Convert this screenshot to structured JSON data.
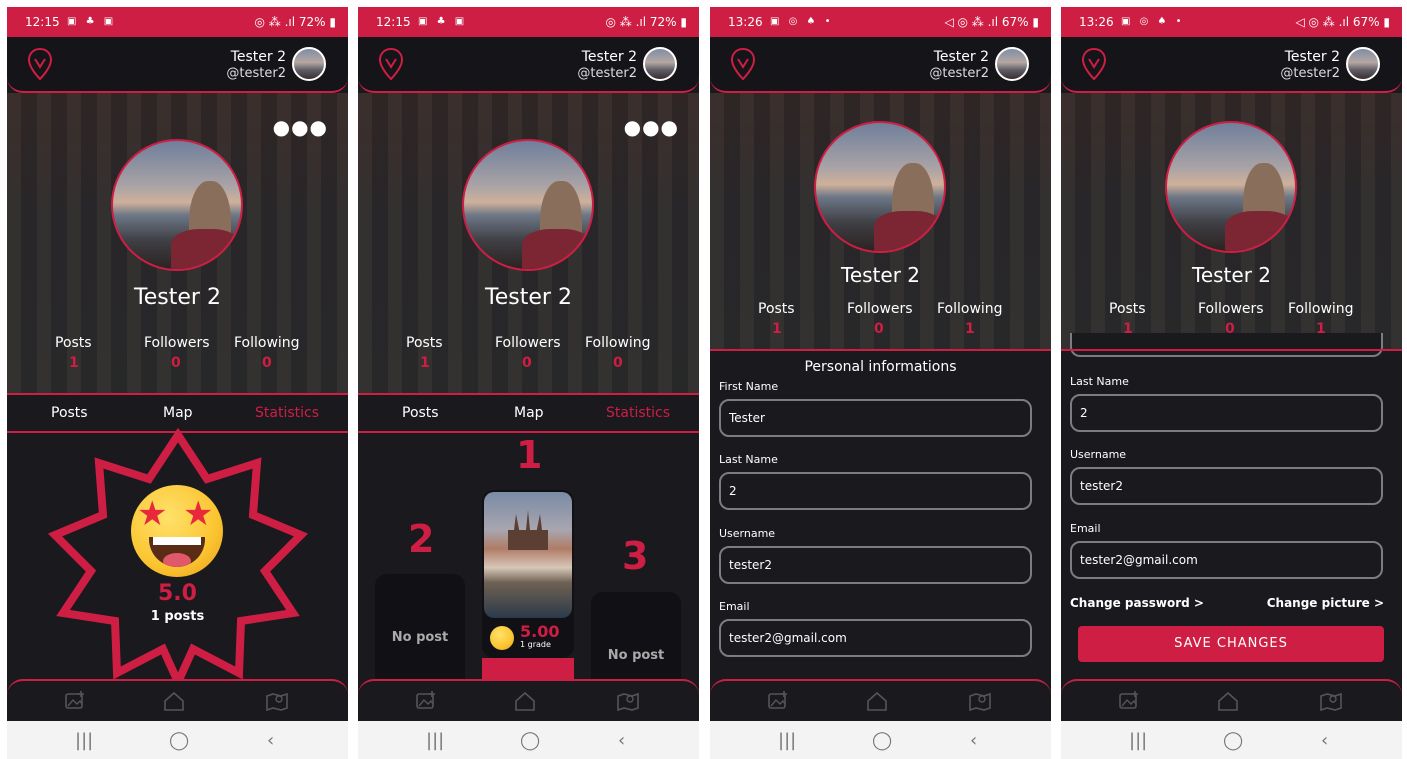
{
  "colors": {
    "accent": "#cf1e44",
    "background": "#1a191e",
    "header": "#151418"
  },
  "icons": {
    "logo": "location-pin-icon",
    "more": "more-dots-icon",
    "nav": [
      "add-photo-icon",
      "home-icon",
      "map-icon"
    ],
    "system": [
      "recent-apps-icon",
      "home-circle-icon",
      "back-icon"
    ]
  },
  "screens": [
    {
      "status": {
        "time": "12:15",
        "battery": "72%"
      },
      "user": {
        "name": "Tester 2",
        "handle": "@tester2"
      },
      "profile": {
        "name": "Tester 2"
      },
      "stats": [
        {
          "label": "Posts",
          "value": "1"
        },
        {
          "label": "Followers",
          "value": "0"
        },
        {
          "label": "Following",
          "value": "0"
        }
      ],
      "tabs": [
        {
          "label": "Posts"
        },
        {
          "label": "Map"
        },
        {
          "label": "Statistics"
        }
      ],
      "statistics": {
        "grade": "5.0",
        "posts": "1 posts"
      }
    },
    {
      "status": {
        "time": "12:15",
        "battery": "72%"
      },
      "user": {
        "name": "Tester 2",
        "handle": "@tester2"
      },
      "profile": {
        "name": "Tester 2"
      },
      "stats": [
        {
          "label": "Posts",
          "value": "1"
        },
        {
          "label": "Followers",
          "value": "0"
        },
        {
          "label": "Following",
          "value": "0"
        }
      ],
      "tabs": [
        {
          "label": "Posts"
        },
        {
          "label": "Map"
        },
        {
          "label": "Statistics"
        }
      ],
      "podium": {
        "first_rank": "1",
        "second_rank": "2",
        "third_rank": "3",
        "first_grade": "5.00",
        "first_grade_sub": "1 grade",
        "no_post": "No post"
      }
    },
    {
      "status": {
        "time": "13:26",
        "battery": "67%"
      },
      "user": {
        "name": "Tester 2",
        "handle": "@tester2"
      },
      "profile": {
        "name": "Tester 2"
      },
      "stats": [
        {
          "label": "Posts",
          "value": "1"
        },
        {
          "label": "Followers",
          "value": "0"
        },
        {
          "label": "Following",
          "value": "1"
        }
      ],
      "form": {
        "section_title": "Personal informations",
        "first_name_label": "First Name",
        "first_name": "Tester",
        "last_name_label": "Last Name",
        "last_name": "2",
        "username_label": "Username",
        "username": "tester2",
        "email_label": "Email",
        "email": "tester2@gmail.com"
      }
    },
    {
      "status": {
        "time": "13:26",
        "battery": "67%"
      },
      "user": {
        "name": "Tester 2",
        "handle": "@tester2"
      },
      "profile": {
        "name": "Tester 2"
      },
      "stats": [
        {
          "label": "Posts",
          "value": "1"
        },
        {
          "label": "Followers",
          "value": "0"
        },
        {
          "label": "Following",
          "value": "1"
        }
      ],
      "form": {
        "last_name_label": "Last Name",
        "last_name": "2",
        "username_label": "Username",
        "username": "tester2",
        "email_label": "Email",
        "email": "tester2@gmail.com",
        "change_password": "Change password  >",
        "change_picture": "Change picture  >",
        "save": "SAVE CHANGES"
      }
    }
  ]
}
